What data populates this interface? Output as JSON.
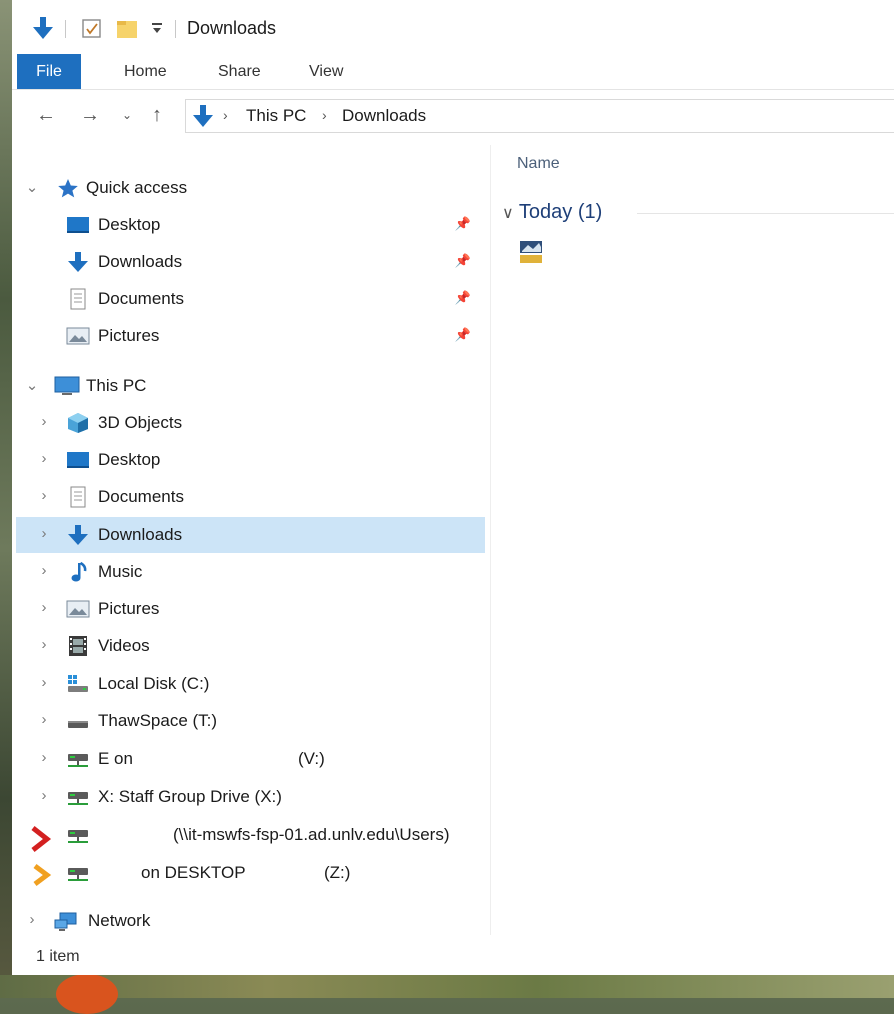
{
  "window": {
    "title": "Downloads"
  },
  "ribbon": {
    "tabs": [
      "File",
      "Home",
      "Share",
      "View"
    ]
  },
  "address": {
    "crumbs": [
      "This PC",
      "Downloads"
    ]
  },
  "nav": {
    "quick_access": {
      "label": "Quick access",
      "items": [
        "Desktop",
        "Downloads",
        "Documents",
        "Pictures"
      ]
    },
    "this_pc": {
      "label": "This PC",
      "items": [
        "3D Objects",
        "Desktop",
        "Documents",
        "Downloads",
        "Music",
        "Pictures",
        "Videos",
        "Local Disk (C:)",
        "ThawSpace (T:)"
      ]
    },
    "drives": {
      "e_on": "E on",
      "e_letter": "(V:)",
      "x_drive": "X: Staff Group Drive (X:)",
      "users_path": "(\\\\it-mswfs-fsp-01.ad.unlv.edu\\Users)",
      "z_on": "on DESKTOP",
      "z_letter": "(Z:)"
    },
    "network": "Network",
    "selected": "Downloads"
  },
  "content": {
    "column_name": "Name",
    "group": "Today (1)"
  },
  "status": {
    "items": "1 item"
  },
  "colors": {
    "accent": "#1e6fbf",
    "selection": "#cce4f7",
    "arrow_red": "#d32020",
    "arrow_yellow": "#f0a020"
  }
}
